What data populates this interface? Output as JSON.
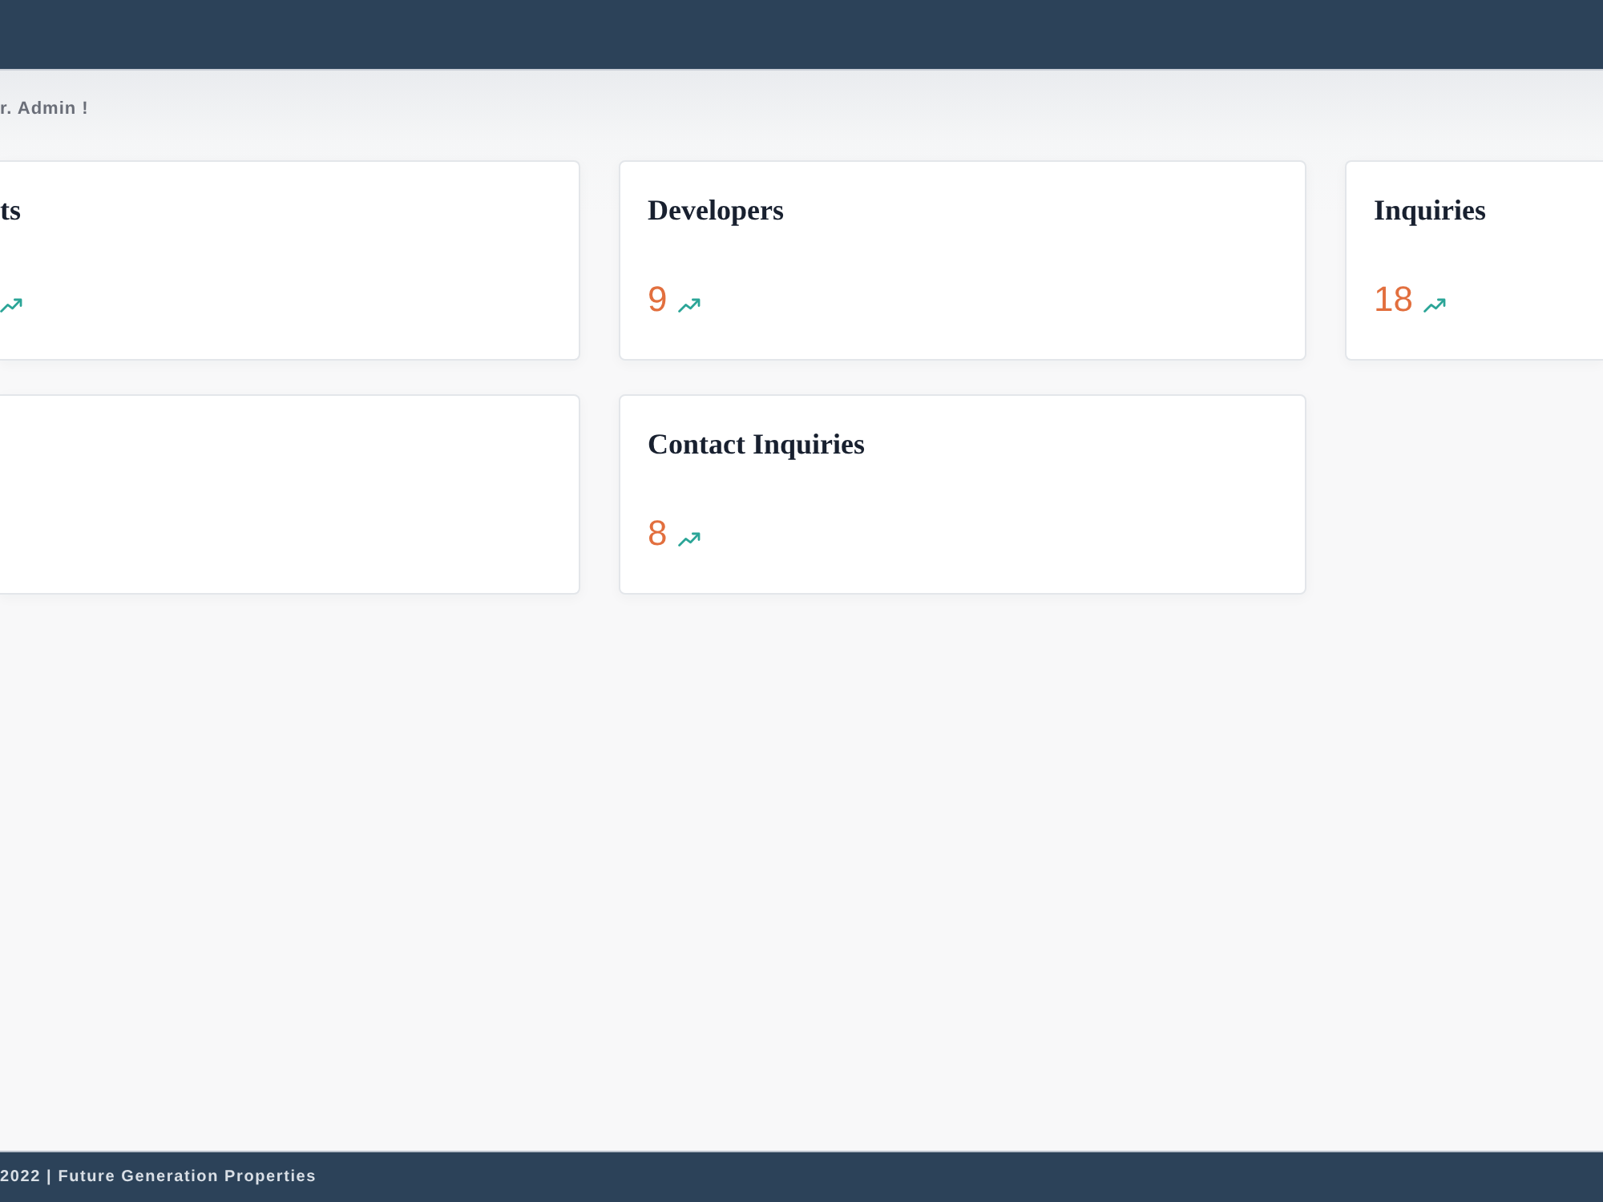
{
  "greeting": "r. Admin !",
  "cards": [
    {
      "kind": "cut-left",
      "title": "ts",
      "trend_icon": true
    },
    {
      "kind": "full",
      "title": "Developers",
      "value": "9",
      "trend_icon": true
    },
    {
      "kind": "cut-right",
      "title": "Inquiries",
      "value": "18",
      "trend_icon": true
    },
    {
      "kind": "cut-left",
      "trend_icon": false
    },
    {
      "kind": "full",
      "title": "Contact Inquiries",
      "value": "8",
      "trend_icon": true
    }
  ],
  "footer": {
    "text": "2022 | Future Generation Properties"
  }
}
